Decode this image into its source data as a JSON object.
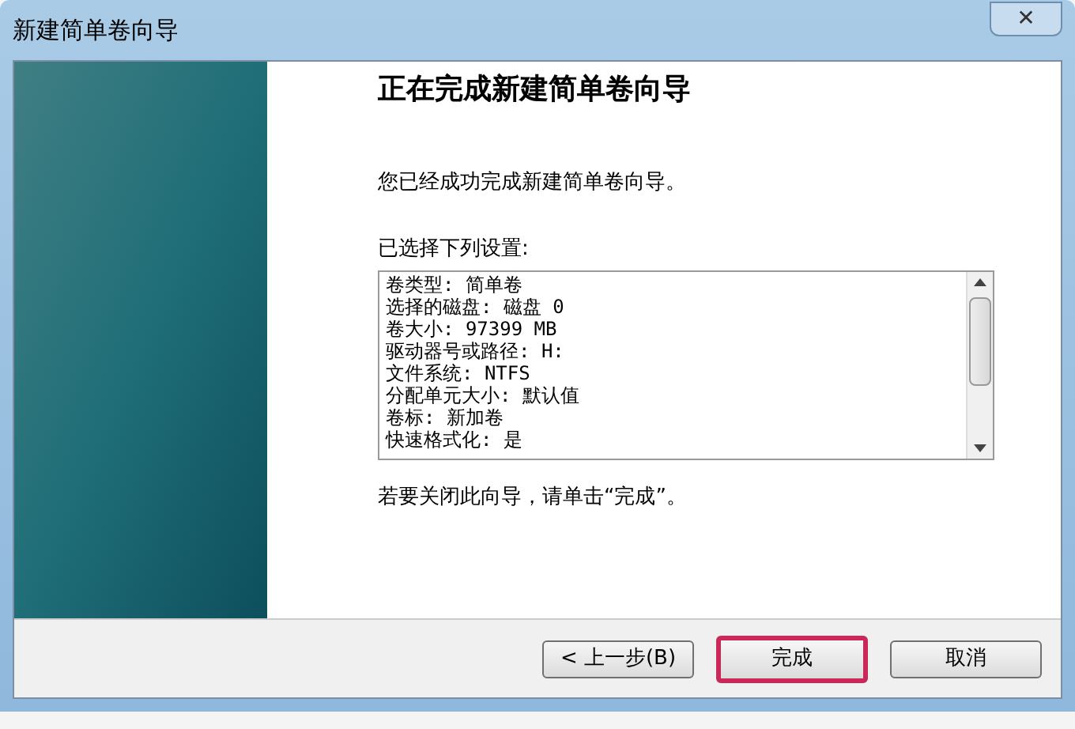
{
  "window": {
    "title": "新建简单卷向导",
    "close": "✕"
  },
  "heading": "正在完成新建简单卷向导",
  "intro": "您已经成功完成新建简单卷向导。",
  "settings_label": "已选择下列设置:",
  "settings": [
    "卷类型: 简单卷",
    "选择的磁盘: 磁盘 0",
    "卷大小: 97399 MB",
    "驱动器号或路径: H:",
    "文件系统: NTFS",
    "分配单元大小: 默认值",
    "卷标: 新加卷",
    "快速格式化: 是"
  ],
  "hint": "若要关闭此向导，请单击“完成”。",
  "buttons": [
    {
      "label": "< 上一步(B)",
      "highlighted": false
    },
    {
      "label": "完成",
      "highlighted": true
    },
    {
      "label": "取消",
      "highlighted": false
    }
  ]
}
